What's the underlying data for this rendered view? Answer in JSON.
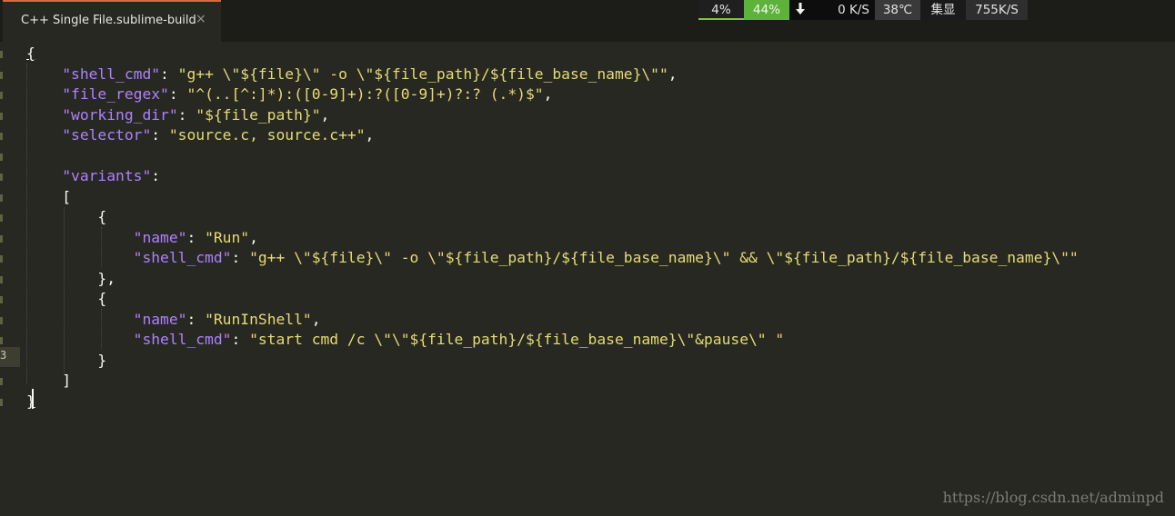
{
  "tab": {
    "title": "C++ Single File.sublime-build",
    "close_glyph": "×"
  },
  "sysmon": {
    "cpu": "4%",
    "memory": "44%",
    "download_icon": "arrow-down-icon",
    "net_down": "0 K/S",
    "temperature": "38℃",
    "gpu_label": "集显",
    "net_up": "755K/S"
  },
  "editor": {
    "current_line_number": "3",
    "lines": [
      [
        {
          "t": "{",
          "c": "p ul"
        }
      ],
      [
        {
          "t": "    ",
          "c": "p"
        },
        {
          "t": "\"shell_cmd\"",
          "c": "k"
        },
        {
          "t": ": ",
          "c": "p"
        },
        {
          "t": "\"g++ \\\"${file}\\\" -o \\\"${file_path}/${file_base_name}\\\"\"",
          "c": "s"
        },
        {
          "t": ",",
          "c": "p"
        }
      ],
      [
        {
          "t": "    ",
          "c": "p"
        },
        {
          "t": "\"file_regex\"",
          "c": "k"
        },
        {
          "t": ": ",
          "c": "p"
        },
        {
          "t": "\"^(..[^:]*):([0-9]+):?([0-9]+)?:? (.*)$\"",
          "c": "s"
        },
        {
          "t": ",",
          "c": "p"
        }
      ],
      [
        {
          "t": "    ",
          "c": "p"
        },
        {
          "t": "\"working_dir\"",
          "c": "k"
        },
        {
          "t": ": ",
          "c": "p"
        },
        {
          "t": "\"${file_path}\"",
          "c": "s"
        },
        {
          "t": ",",
          "c": "p"
        }
      ],
      [
        {
          "t": "    ",
          "c": "p"
        },
        {
          "t": "\"selector\"",
          "c": "k"
        },
        {
          "t": ": ",
          "c": "p"
        },
        {
          "t": "\"source.c, source.c++\"",
          "c": "s"
        },
        {
          "t": ",",
          "c": "p"
        }
      ],
      [],
      [
        {
          "t": "    ",
          "c": "p"
        },
        {
          "t": "\"variants\"",
          "c": "k"
        },
        {
          "t": ":",
          "c": "p"
        }
      ],
      [
        {
          "t": "    [",
          "c": "p"
        }
      ],
      [
        {
          "t": "        {",
          "c": "p"
        }
      ],
      [
        {
          "t": "            ",
          "c": "p"
        },
        {
          "t": "\"name\"",
          "c": "k"
        },
        {
          "t": ": ",
          "c": "p"
        },
        {
          "t": "\"Run\"",
          "c": "s"
        },
        {
          "t": ",",
          "c": "p"
        }
      ],
      [
        {
          "t": "            ",
          "c": "p"
        },
        {
          "t": "\"shell_cmd\"",
          "c": "k"
        },
        {
          "t": ": ",
          "c": "p"
        },
        {
          "t": "\"g++ \\\"${file}\\\" -o \\\"${file_path}/${file_base_name}\\\" && \\\"${file_path}/${file_base_name}\\\"\"",
          "c": "s"
        }
      ],
      [
        {
          "t": "        },",
          "c": "p"
        }
      ],
      [
        {
          "t": "        {",
          "c": "p"
        }
      ],
      [
        {
          "t": "            ",
          "c": "p"
        },
        {
          "t": "\"name\"",
          "c": "k"
        },
        {
          "t": ": ",
          "c": "p"
        },
        {
          "t": "\"RunInShell\"",
          "c": "s"
        },
        {
          "t": ",",
          "c": "p"
        }
      ],
      [
        {
          "t": "            ",
          "c": "p"
        },
        {
          "t": "\"shell_cmd\"",
          "c": "k"
        },
        {
          "t": ": ",
          "c": "p"
        },
        {
          "t": "\"start cmd /c \\\"\\\"${file_path}/${file_base_name}\\\"&pause\\\" \"",
          "c": "s"
        }
      ],
      [
        {
          "t": "        }",
          "c": "p"
        }
      ],
      [
        {
          "t": "    ]",
          "c": "p"
        }
      ],
      [
        {
          "t": "}",
          "c": "p ul"
        }
      ]
    ]
  },
  "watermark": "https://blog.csdn.net/adminpd",
  "colors": {
    "background": "#272822",
    "keyword_purple": "#ae81ff",
    "string_yellow": "#e6db74",
    "text": "#f8f8f2",
    "tab_accent": "#d8683f",
    "memory_green": "#5db33a"
  }
}
